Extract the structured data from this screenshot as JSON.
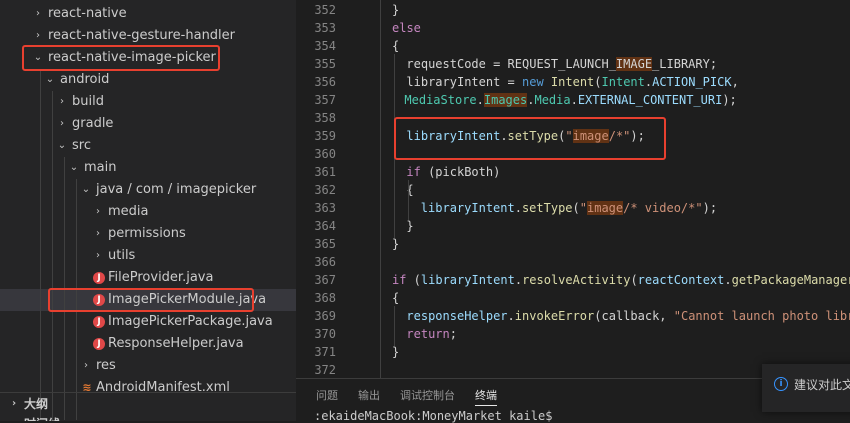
{
  "explorer": {
    "items": [
      {
        "label": "react-native",
        "depth": 0,
        "type": "folder",
        "expanded": false
      },
      {
        "label": "react-native-gesture-handler",
        "depth": 0,
        "type": "folder",
        "expanded": false
      },
      {
        "label": "react-native-image-picker",
        "depth": 0,
        "type": "folder",
        "expanded": true
      },
      {
        "label": "android",
        "depth": 1,
        "type": "folder",
        "expanded": true
      },
      {
        "label": "build",
        "depth": 2,
        "type": "folder",
        "expanded": false
      },
      {
        "label": "gradle",
        "depth": 2,
        "type": "folder",
        "expanded": false
      },
      {
        "label": "src",
        "depth": 2,
        "type": "folder",
        "expanded": true
      },
      {
        "label": "main",
        "depth": 3,
        "type": "folder",
        "expanded": true
      },
      {
        "label": "java / com / imagepicker",
        "depth": 4,
        "type": "folder",
        "expanded": true
      },
      {
        "label": "media",
        "depth": 5,
        "type": "folder",
        "expanded": false
      },
      {
        "label": "permissions",
        "depth": 5,
        "type": "folder",
        "expanded": false
      },
      {
        "label": "utils",
        "depth": 5,
        "type": "folder",
        "expanded": false
      },
      {
        "label": "FileProvider.java",
        "depth": 5,
        "type": "java"
      },
      {
        "label": "ImagePickerModule.java",
        "depth": 5,
        "type": "java",
        "selected": true
      },
      {
        "label": "ImagePickerPackage.java",
        "depth": 5,
        "type": "java"
      },
      {
        "label": "ResponseHelper.java",
        "depth": 5,
        "type": "java"
      },
      {
        "label": "res",
        "depth": 4,
        "type": "folder",
        "expanded": false
      },
      {
        "label": "AndroidManifest.xml",
        "depth": 4,
        "type": "xml"
      }
    ],
    "outline_label": "大纲",
    "timeline_label": "时间线"
  },
  "editor": {
    "lines": [
      {
        "num": "352",
        "indent": 1,
        "tokens": [
          [
            "}",
            "plain"
          ]
        ]
      },
      {
        "num": "353",
        "indent": 1,
        "tokens": [
          [
            "else",
            "kw"
          ]
        ]
      },
      {
        "num": "354",
        "indent": 1,
        "tokens": [
          [
            "{",
            "plain"
          ]
        ]
      },
      {
        "num": "355",
        "indent": 2,
        "tokens": [
          [
            "requestCode",
            "plain"
          ],
          [
            " = REQUEST_LAUNCH_",
            "plain"
          ],
          [
            "IMAGE",
            "plain match"
          ],
          [
            "_LIBRARY;",
            "plain"
          ]
        ]
      },
      {
        "num": "356",
        "indent": 2,
        "tokens": [
          [
            "libraryIntent",
            "plain"
          ],
          [
            " = ",
            "plain"
          ],
          [
            "new",
            "kwb"
          ],
          [
            " ",
            "plain"
          ],
          [
            "Intent",
            "fn"
          ],
          [
            "(",
            "plain"
          ],
          [
            "Intent",
            "cls"
          ],
          [
            ".",
            "plain"
          ],
          [
            "ACTION_PICK",
            "var"
          ],
          [
            ",",
            "plain"
          ]
        ]
      },
      {
        "num": "357",
        "indent": 2,
        "prefix": "-2",
        "tokens": [
          [
            "MediaStore",
            "cls"
          ],
          [
            ".",
            "plain"
          ],
          [
            "Images",
            "cls match"
          ],
          [
            ".",
            "plain"
          ],
          [
            "Media",
            "cls"
          ],
          [
            ".",
            "plain"
          ],
          [
            "EXTERNAL_CONTENT_URI",
            "var"
          ],
          [
            ");",
            "plain"
          ]
        ]
      },
      {
        "num": "358",
        "indent": 2,
        "tokens": []
      },
      {
        "num": "359",
        "indent": 2,
        "tokens": [
          [
            "libraryIntent",
            "var"
          ],
          [
            ".",
            "plain"
          ],
          [
            "setType",
            "fn"
          ],
          [
            "(",
            "plain"
          ],
          [
            "\"",
            "str"
          ],
          [
            "image",
            "str match"
          ],
          [
            "/*\"",
            "str"
          ],
          [
            ");",
            "plain"
          ]
        ]
      },
      {
        "num": "360",
        "indent": 2,
        "tokens": []
      },
      {
        "num": "361",
        "indent": 2,
        "tokens": [
          [
            "if",
            "kw"
          ],
          [
            " (pickBoth)",
            "plain"
          ]
        ]
      },
      {
        "num": "362",
        "indent": 2,
        "tokens": [
          [
            "{",
            "plain"
          ]
        ]
      },
      {
        "num": "363",
        "indent": 3,
        "tokens": [
          [
            "libraryIntent",
            "var"
          ],
          [
            ".",
            "plain"
          ],
          [
            "setType",
            "fn"
          ],
          [
            "(",
            "plain"
          ],
          [
            "\"",
            "str"
          ],
          [
            "image",
            "str match"
          ],
          [
            "/* video/*\"",
            "str"
          ],
          [
            ");",
            "plain"
          ]
        ]
      },
      {
        "num": "364",
        "indent": 2,
        "tokens": [
          [
            "}",
            "plain"
          ]
        ]
      },
      {
        "num": "365",
        "indent": 1,
        "tokens": [
          [
            "}",
            "plain"
          ]
        ]
      },
      {
        "num": "366",
        "indent": 1,
        "tokens": []
      },
      {
        "num": "367",
        "indent": 1,
        "tokens": [
          [
            "if",
            "kw"
          ],
          [
            " (",
            "plain"
          ],
          [
            "libraryIntent",
            "var"
          ],
          [
            ".",
            "plain"
          ],
          [
            "resolveActivity",
            "fn"
          ],
          [
            "(",
            "plain"
          ],
          [
            "reactContext",
            "var"
          ],
          [
            ".",
            "plain"
          ],
          [
            "getPackageManager",
            "fn"
          ]
        ]
      },
      {
        "num": "368",
        "indent": 1,
        "tokens": [
          [
            "{",
            "plain"
          ]
        ]
      },
      {
        "num": "369",
        "indent": 2,
        "tokens": [
          [
            "responseHelper",
            "var"
          ],
          [
            ".",
            "plain"
          ],
          [
            "invokeError",
            "fn"
          ],
          [
            "(callback, ",
            "plain"
          ],
          [
            "\"Cannot launch photo libr",
            "str"
          ]
        ]
      },
      {
        "num": "370",
        "indent": 2,
        "tokens": [
          [
            "return",
            "kw"
          ],
          [
            ";",
            "plain"
          ]
        ]
      },
      {
        "num": "371",
        "indent": 1,
        "tokens": [
          [
            "}",
            "plain"
          ]
        ]
      },
      {
        "num": "372",
        "indent": 1,
        "tokens": []
      }
    ]
  },
  "panel": {
    "tabs": [
      {
        "label": "问题",
        "active": false
      },
      {
        "label": "输出",
        "active": false
      },
      {
        "label": "调试控制台",
        "active": false
      },
      {
        "label": "终端",
        "active": true
      }
    ],
    "terminal_text": ":ekaideMacBook:MoneyMarket kaile$"
  },
  "notification": {
    "text": "建议对此文"
  },
  "colors": {
    "highlight_box": "#e8402f",
    "selection": "#37373d",
    "accent": "#3794ff"
  }
}
